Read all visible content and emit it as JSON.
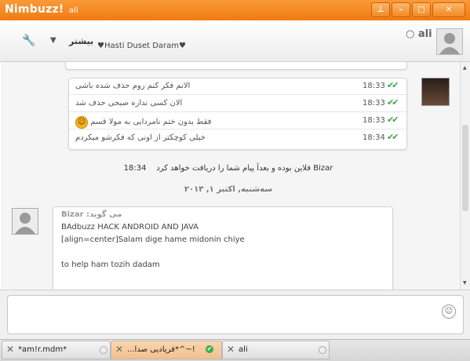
{
  "titlebar": {
    "app_name": "Nimbuzz!",
    "user": "ali",
    "colors": {
      "accent": "#f58a1f"
    }
  },
  "window_buttons": [
    "pin",
    "minimize",
    "maximize",
    "close"
  ],
  "header": {
    "more_label": "بیشتر",
    "status_message": "♥Hasti Duset Daram♥",
    "contact_name": "ali"
  },
  "chat": {
    "messages": [
      {
        "text": "الانم فکر کنم روم حذف شده باشی",
        "time": "18:33",
        "status": "read"
      },
      {
        "text": "الان کسی نداره صبحی حذف شد",
        "time": "18:33",
        "status": "read"
      },
      {
        "text": "فقط بدون ختم نامردایی به مولا قسم",
        "time": "18:33",
        "status": "read",
        "emoji": "smiley"
      },
      {
        "text": "خیلی کوچکتر از اونی که فکرشو میکردم",
        "time": "18:34",
        "status": "read"
      }
    ],
    "system_message": {
      "time": "18:34",
      "text": "فلاین بوده و بعدآ پیام شما را دریافت خواهد کرد Bizar"
    },
    "date_separator": "سه‌شنبه, اکتبر ۱, ۲۰۱۳",
    "incoming": {
      "header": "Bizar :می گوید",
      "lines": [
        "BAdbuzz HACK ANDROID AND JAVA",
        "[align=center]Salam dige hame midonin chiye",
        "",
        "to help ham tozih dadam"
      ]
    }
  },
  "input": {
    "placeholder": "",
    "emoji_icon": "smiley"
  },
  "tabs": [
    {
      "label": "*am!r.mdm*",
      "active": false
    },
    {
      "label": "...فریادیی صدا*^~!",
      "active": true
    },
    {
      "label": "ali",
      "active": false
    }
  ]
}
